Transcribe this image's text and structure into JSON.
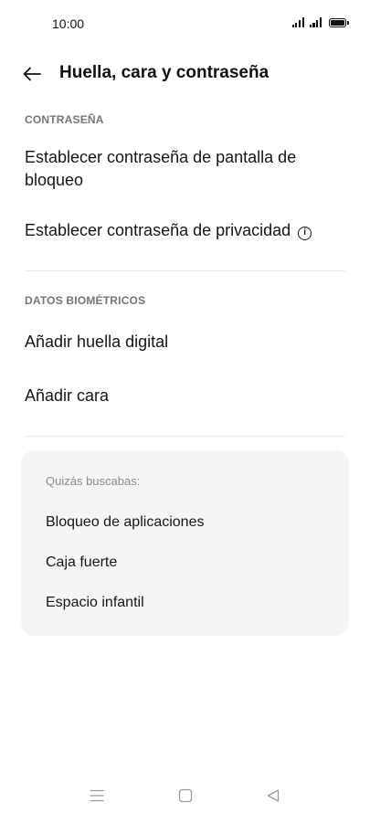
{
  "status_bar": {
    "time": "10:00"
  },
  "header": {
    "title": "Huella, cara y contraseña",
    "back_icon": "arrow-left-icon"
  },
  "sections": {
    "password": {
      "header": "CONTRASEÑA",
      "items": [
        "Establecer contraseña de pantalla de bloqueo",
        "Establecer contraseña de privacidad"
      ]
    },
    "biometrics": {
      "header": "DATOS BIOMÉTRICOS",
      "items": [
        "Añadir huella digital",
        "Añadir cara"
      ]
    }
  },
  "suggestions": {
    "header": "Quizás buscabas:",
    "items": [
      "Bloqueo de aplicaciones",
      "Caja fuerte",
      "Espacio infantil"
    ]
  },
  "nav_bar": {
    "icons": [
      "menu-icon",
      "home-square-icon",
      "back-triangle-icon"
    ]
  },
  "colors": {
    "background": "#ffffff",
    "card": "#f5f5f5",
    "section_header": "#757575",
    "text": "#161616"
  }
}
